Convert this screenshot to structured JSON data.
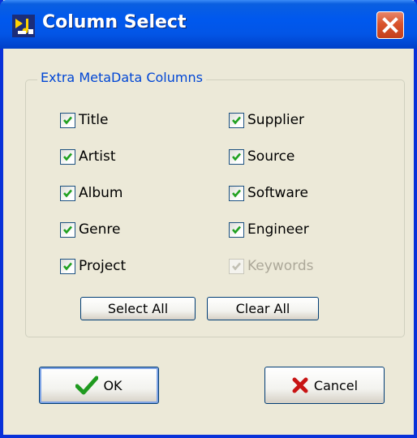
{
  "window": {
    "title": "Column Select"
  },
  "group": {
    "legend": "Extra MetaData Columns"
  },
  "checkboxes_left": [
    {
      "label": "Title",
      "checked": true,
      "enabled": true
    },
    {
      "label": "Artist",
      "checked": true,
      "enabled": true
    },
    {
      "label": "Album",
      "checked": true,
      "enabled": true
    },
    {
      "label": "Genre",
      "checked": true,
      "enabled": true
    },
    {
      "label": "Project",
      "checked": true,
      "enabled": true
    }
  ],
  "checkboxes_right": [
    {
      "label": "Supplier",
      "checked": true,
      "enabled": true
    },
    {
      "label": "Source",
      "checked": true,
      "enabled": true
    },
    {
      "label": "Software",
      "checked": true,
      "enabled": true
    },
    {
      "label": "Engineer",
      "checked": true,
      "enabled": true
    },
    {
      "label": "Keywords",
      "checked": true,
      "enabled": false
    }
  ],
  "buttons": {
    "select_all": "Select All",
    "clear_all": "Clear All",
    "ok": "OK",
    "cancel": "Cancel"
  },
  "icons": {
    "app": "music-note-icon",
    "close": "close-icon",
    "ok": "green-check-icon",
    "cancel": "red-x-icon"
  },
  "colors": {
    "titlebar": "#0058ee",
    "legend_text": "#0046d5",
    "check": "#21a121",
    "close_button": "#d9532c",
    "disabled_text": "#aca899"
  }
}
